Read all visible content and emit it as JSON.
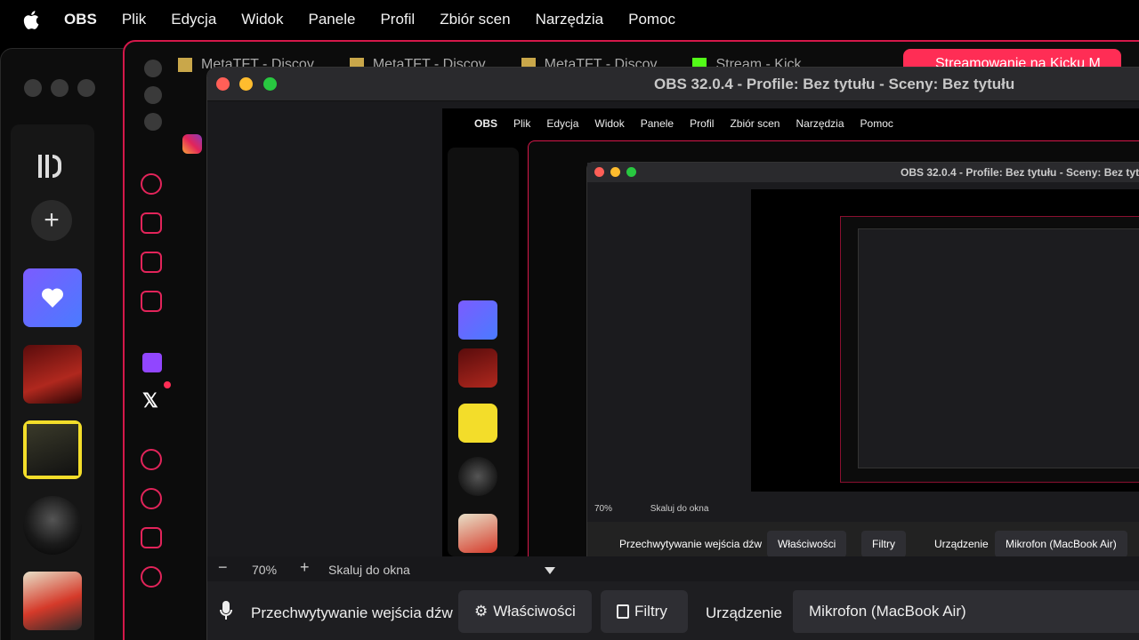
{
  "menubar": {
    "app": "OBS",
    "items": [
      "Plik",
      "Edycja",
      "Widok",
      "Panele",
      "Profil",
      "Zbiór scen",
      "Narzędzia",
      "Pomoc"
    ]
  },
  "browser_tabs": [
    "MetaTFT - Discov",
    "MetaTFT - Discov",
    "MetaTFT - Discov",
    "Stream - Kick",
    "Streamowanie na Kicku M"
  ],
  "obs": {
    "title": "OBS 32.0.4 - Profile: Bez tytułu - Sceny: Bez tytułu",
    "zoom": "70%",
    "scale_label": "Skaluj do okna",
    "source_name": "Przechwytywanie wejścia dźw",
    "properties_label": "Właściwości",
    "filters_label": "Filtry",
    "device_label": "Urządzenie",
    "device_value": "Mikrofon (MacBook Air)"
  },
  "colors": {
    "accent": "#e2245a",
    "kick_tab": "#ff2d55",
    "traffic_red": "#ff5f57",
    "traffic_yellow": "#febc2e",
    "traffic_green": "#28c840"
  }
}
